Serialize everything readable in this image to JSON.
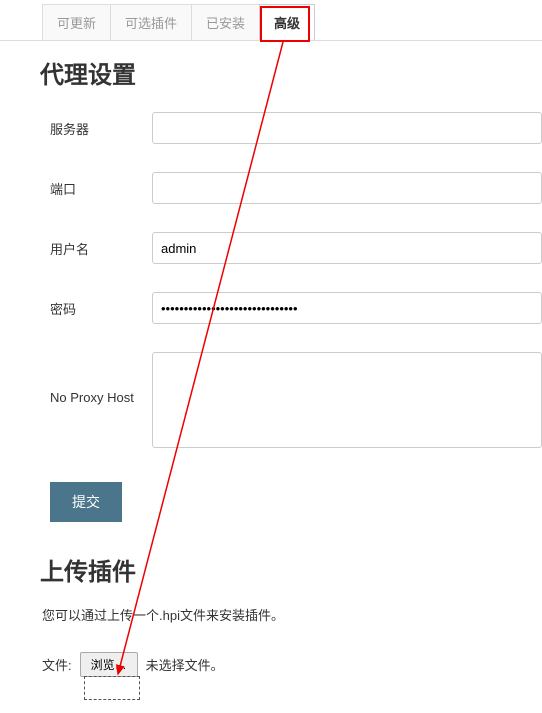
{
  "tabs": {
    "updatable": "可更新",
    "available": "可选插件",
    "installed": "已安装",
    "advanced": "高级"
  },
  "proxy": {
    "title": "代理设置",
    "server_label": "服务器",
    "server_value": "",
    "port_label": "端口",
    "port_value": "",
    "username_label": "用户名",
    "username_value": "admin",
    "password_label": "密码",
    "password_value": "••••••••••••••••••••••••••••••",
    "noproxy_label": "No Proxy Host",
    "noproxy_value": "",
    "submit_label": "提交"
  },
  "upload": {
    "title": "上传插件",
    "desc": "您可以通过上传一个.hpi文件来安装插件。",
    "file_label": "文件:",
    "browse_label": "浏览…",
    "file_status": "未选择文件。"
  }
}
